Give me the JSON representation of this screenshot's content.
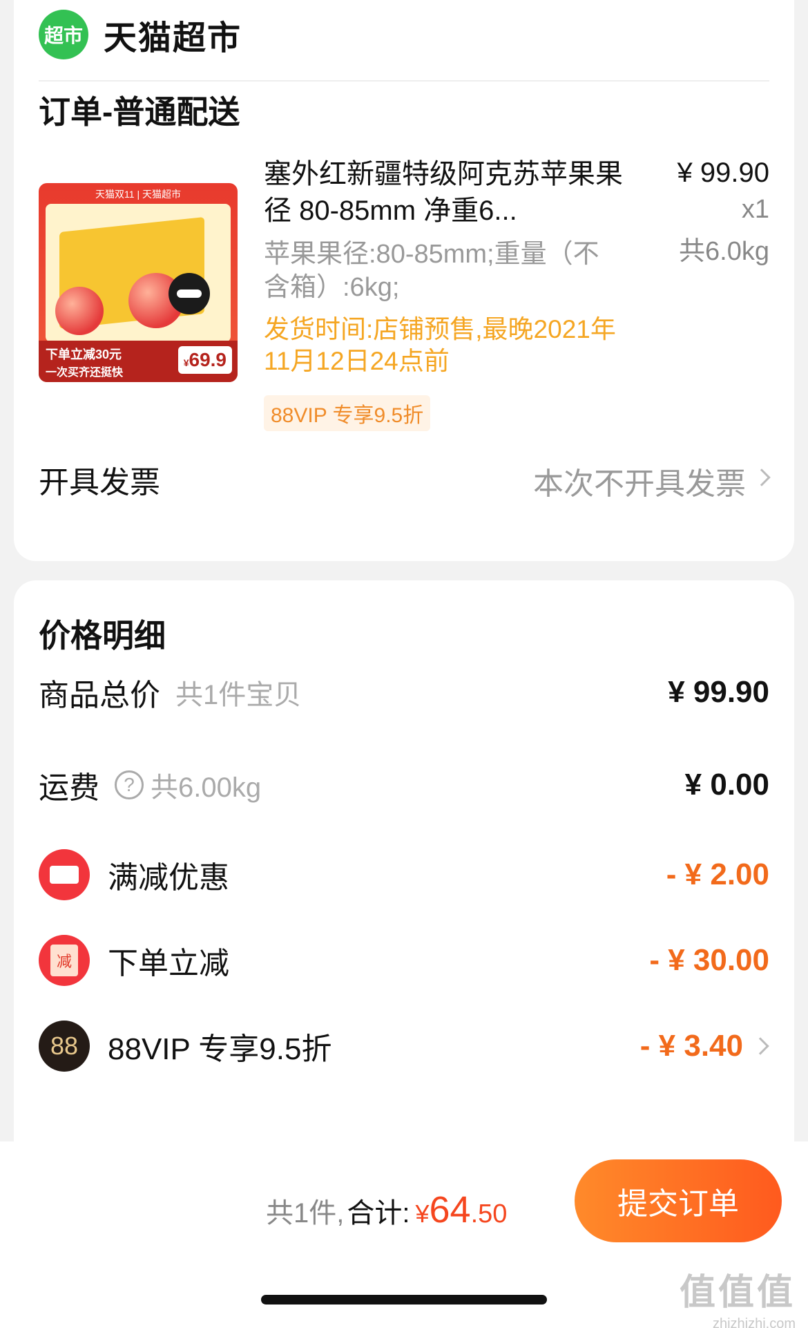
{
  "shop": {
    "badge": "超市",
    "name": "天猫超市"
  },
  "order": {
    "section_title": "订单-普通配送",
    "thumbnail": {
      "top_text": "天猫双11 | 天猫超市",
      "line1": "下单立减30元",
      "line2": "一次买齐还挺快",
      "price_symbol": "¥",
      "price": "69.9"
    },
    "product_title": "塞外红新疆特级阿克苏苹果果径 80-85mm 净重6...",
    "price": "¥ 99.90",
    "qty": "x1",
    "weight": "共6.0kg",
    "spec": "苹果果径:80-85mm;重量（不含箱）:6kg;",
    "shipping": "发货时间:店铺预售,最晚2021年11月12日24点前",
    "vip_tag": "88VIP 专享9.5折",
    "invoice_label": "开具发票",
    "invoice_value": "本次不开具发票"
  },
  "price_detail": {
    "title": "价格明细",
    "rows": [
      {
        "label": "商品总价",
        "sub": "共1件宝贝",
        "amount": "¥ 99.90"
      },
      {
        "label": "运费",
        "sub": "共6.00kg",
        "amount": "¥ 0.00"
      },
      {
        "label": "满减优惠",
        "amount": "- ¥ 2.00"
      },
      {
        "label": "下单立减",
        "icon_text": "减",
        "amount": "- ¥ 30.00"
      },
      {
        "label": "88VIP 专享9.5折",
        "icon_text": "88",
        "amount": "- ¥ 3.40"
      }
    ]
  },
  "footer": {
    "count": "共1件,",
    "total_label": "合计:",
    "currency": "¥",
    "total_int": "64",
    "total_dec": ".50",
    "submit": "提交订单"
  },
  "watermark": {
    "glyphs": "值值值",
    "url": "zhizhizhi.com"
  },
  "colors": {
    "accent": "#ff5a1e",
    "discount": "#f26a1b",
    "shop_green": "#33c153"
  }
}
